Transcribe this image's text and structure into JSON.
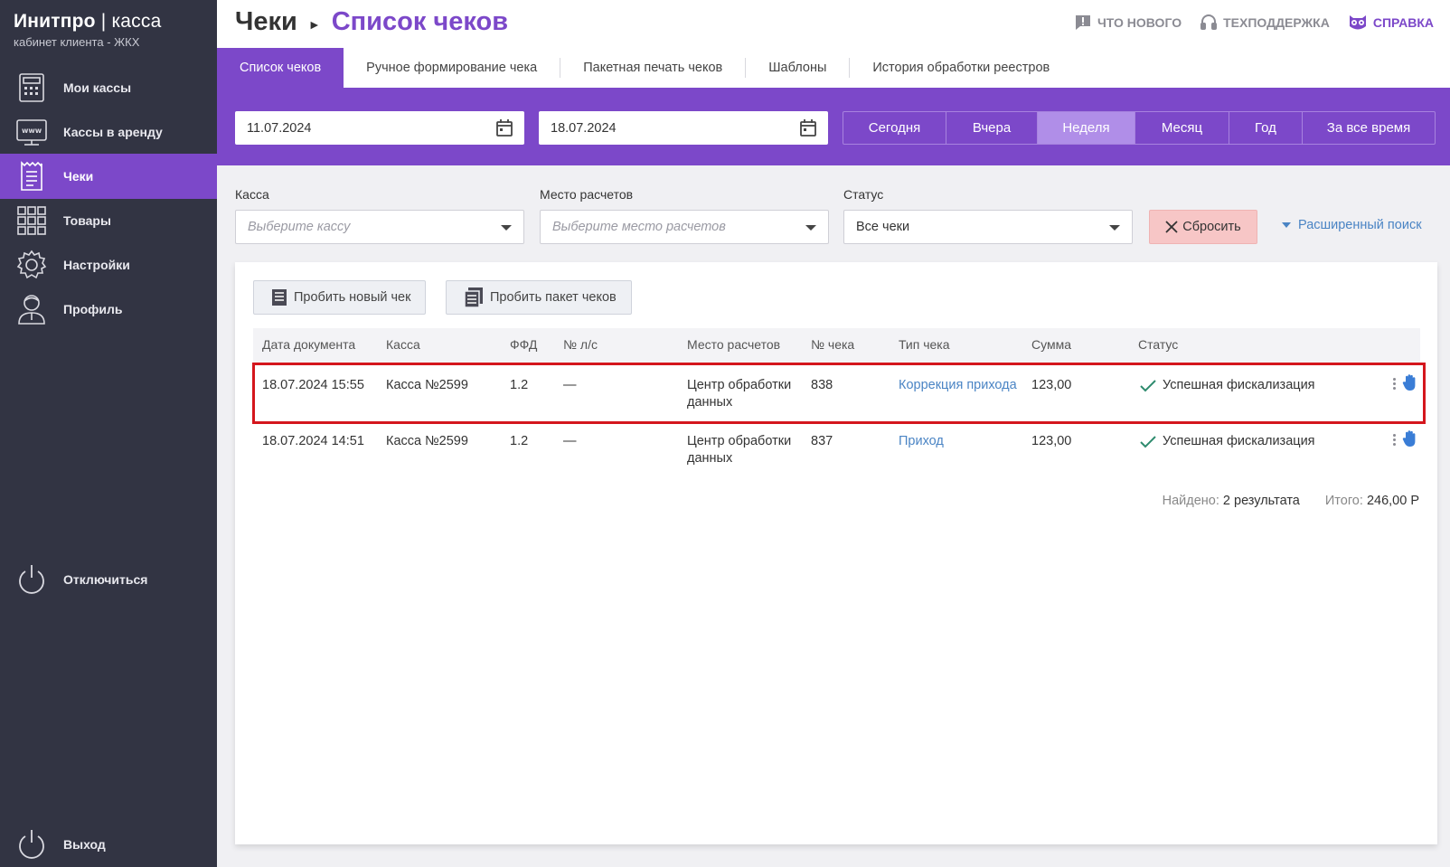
{
  "brand": {
    "title_bold": "Инитпро",
    "title_sep": " | ",
    "title_thin": "касса",
    "subtitle": "кабинет клиента - ЖКХ"
  },
  "sidebar": {
    "items": [
      {
        "label": "Мои кассы",
        "icon": "cash-register-icon"
      },
      {
        "label": "Кассы в аренду",
        "icon": "www-terminal-icon"
      },
      {
        "label": "Чеки",
        "icon": "receipt-icon",
        "active": true
      },
      {
        "label": "Товары",
        "icon": "grid-icon"
      },
      {
        "label": "Настройки",
        "icon": "gear-icon"
      },
      {
        "label": "Профиль",
        "icon": "user-icon"
      }
    ],
    "disconnect": "Отключиться",
    "logout": "Выход"
  },
  "header": {
    "crumb_root": "Чеки",
    "crumb_current": "Список чеков",
    "links": {
      "whats_new": "ЧТО НОВОГО",
      "support": "ТЕХПОДДЕРЖКА",
      "help": "СПРАВКА"
    }
  },
  "tabs": [
    {
      "label": "Список чеков",
      "active": true
    },
    {
      "label": "Ручное формирование чека"
    },
    {
      "label": "Пакетная печать чеков"
    },
    {
      "label": "Шаблоны"
    },
    {
      "label": "История обработки реестров"
    }
  ],
  "dates": {
    "from": "11.07.2024",
    "to": "18.07.2024"
  },
  "periods": [
    {
      "label": "Сегодня"
    },
    {
      "label": "Вчера"
    },
    {
      "label": "Неделя",
      "active": true
    },
    {
      "label": "Месяц"
    },
    {
      "label": "Год"
    },
    {
      "label": "За все время"
    }
  ],
  "filters": {
    "kassa": {
      "label": "Касса",
      "placeholder": "Выберите кассу"
    },
    "place": {
      "label": "Место расчетов",
      "placeholder": "Выберите место расчетов"
    },
    "status": {
      "label": "Статус",
      "value": "Все чеки"
    },
    "reset": "Сбросить",
    "advanced": "Расширенный поиск"
  },
  "actions": {
    "new_check": "Пробить новый чек",
    "batch": "Пробить пакет чеков"
  },
  "table": {
    "headers": [
      "Дата документа",
      "Касса",
      "ФФД",
      "№ л/с",
      "Место расчетов",
      "№ чека",
      "Тип чека",
      "Сумма",
      "Статус"
    ],
    "rows": [
      {
        "date": "18.07.2024 15:55",
        "kassa": "Касса №2599",
        "ffd": "1.2",
        "ls": "—",
        "place1": "Центр обработки",
        "place2": "данных",
        "num": "838",
        "type": "Коррекция прихода",
        "sum": "123,00",
        "status": "Успешная фискализация"
      },
      {
        "date": "18.07.2024 14:51",
        "kassa": "Касса №2599",
        "ffd": "1.2",
        "ls": "—",
        "place1": "Центр обработки",
        "place2": "данных",
        "num": "837",
        "type": "Приход",
        "sum": "123,00",
        "status": "Успешная фискализация"
      }
    ]
  },
  "summary": {
    "found_label": "Найдено:",
    "found_value": "2 результата",
    "total_label": "Итого:",
    "total_value": "246,00 Р"
  },
  "colors": {
    "accent": "#7c48c9",
    "sidebar": "#323443",
    "link": "#4a84c4",
    "highlight": "#d4161d",
    "success": "#2e8b6e"
  }
}
